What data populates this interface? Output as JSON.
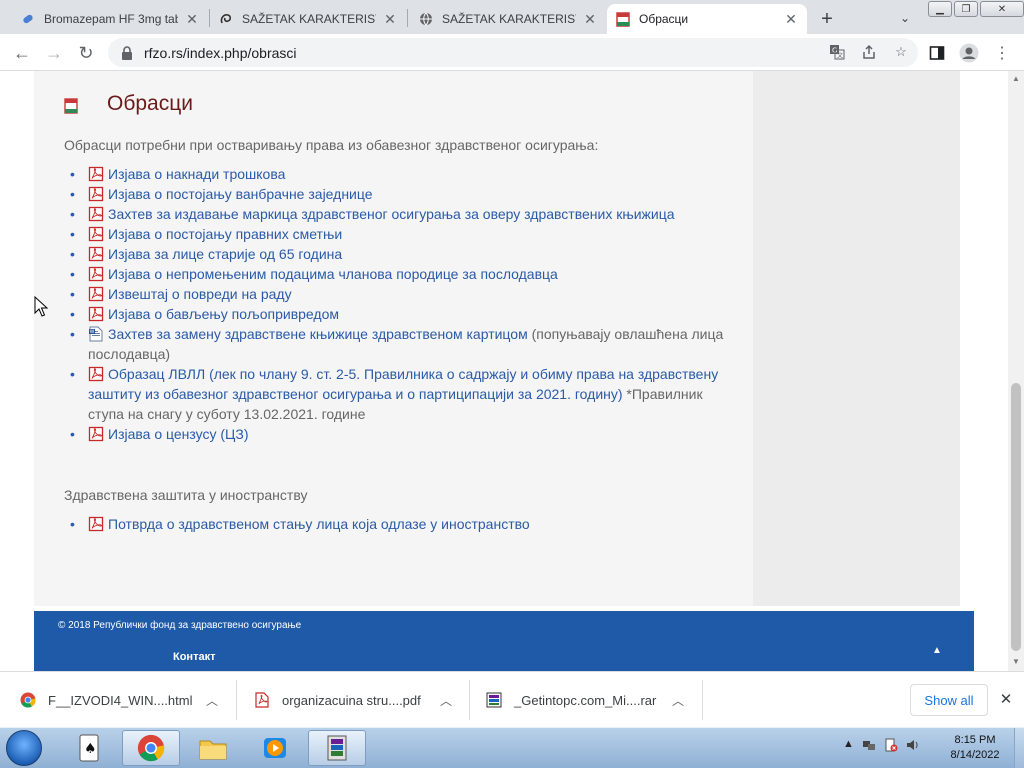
{
  "tabs": [
    {
      "title": "Bromazepam HF 3mg tab",
      "icon": "pill-icon"
    },
    {
      "title": "SAŽETAK KARAKTERISTIK",
      "icon": "spiral-icon"
    },
    {
      "title": "SAŽETAK KARAKTERISTIK",
      "icon": "globe-icon"
    },
    {
      "title": "Обрасци",
      "icon": "rfzo-icon",
      "active": true
    }
  ],
  "toolbar": {
    "url": "rfzo.rs/index.php/obrasci"
  },
  "page": {
    "title": "Обрасци",
    "intro": "Обрасци потребни при остваривању права из обавезног здравственог осигурања:",
    "forms": [
      {
        "link": "Изјава о накнади трошкова",
        "note": "",
        "icon": "pdf-icon"
      },
      {
        "link": "Изјава о постојању ванбрачне заједнице",
        "note": "",
        "icon": "pdf-icon"
      },
      {
        "link": "Захтев за издавање маркица здравственог осигурања за оверу здравствених књижица",
        "note": "",
        "icon": "pdf-icon"
      },
      {
        "link": "Изјава о постојању правних сметњи",
        "note": "",
        "icon": "pdf-icon"
      },
      {
        "link": "Изјава за лице старије од 65 година",
        "note": "",
        "icon": "pdf-icon"
      },
      {
        "link": "Изјава о непромењеним подацима чланова породице за послодавца",
        "note": "",
        "icon": "pdf-icon"
      },
      {
        "link": "Извештај о повреди на раду",
        "note": "",
        "icon": "pdf-icon"
      },
      {
        "link": "Изјава о бављењу пољопривредом",
        "note": "",
        "icon": "pdf-icon"
      },
      {
        "link": "Захтев за замену здравствене књижице здравственом картицом",
        "note": " (попуњавају овлашћена лица послодавца)",
        "icon": "word-icon"
      },
      {
        "link": "Образац ЛВЛЛ (лек по члану 9. ст. 2-5. Правилника о садржају и обиму права на здравствену заштиту из обавезног здравственог осигурања и о партиципацији за 2021. годину)",
        "note": " *Правилник ступа на снагу у суботу 13.02.2021. године",
        "icon": "pdf-icon"
      },
      {
        "link": "Изјава о цензусу (ЦЗ)",
        "note": "",
        "icon": "pdf-icon"
      }
    ],
    "abroad_heading": "Здравствена заштита у иностранству",
    "abroad_forms": [
      {
        "link": "Потврда о здравственом стању лица која одлазе у иностранство",
        "icon": "pdf-icon"
      }
    ]
  },
  "footer": {
    "copyright": "© 2018 Републички фонд за здравствено осигурање",
    "contact": "Контакт"
  },
  "downloads": [
    {
      "name": "F__IZVODI4_WIN....html",
      "icon": "chrome-icon"
    },
    {
      "name": "organizacuina stru....pdf",
      "icon": "pdf-icon"
    },
    {
      "name": "_Getintopc.com_Mi....rar",
      "icon": "rar-icon"
    }
  ],
  "download_shelf": {
    "show_all": "Show all"
  },
  "taskbar": {
    "time": "8:15 PM",
    "date": "8/14/2022"
  }
}
